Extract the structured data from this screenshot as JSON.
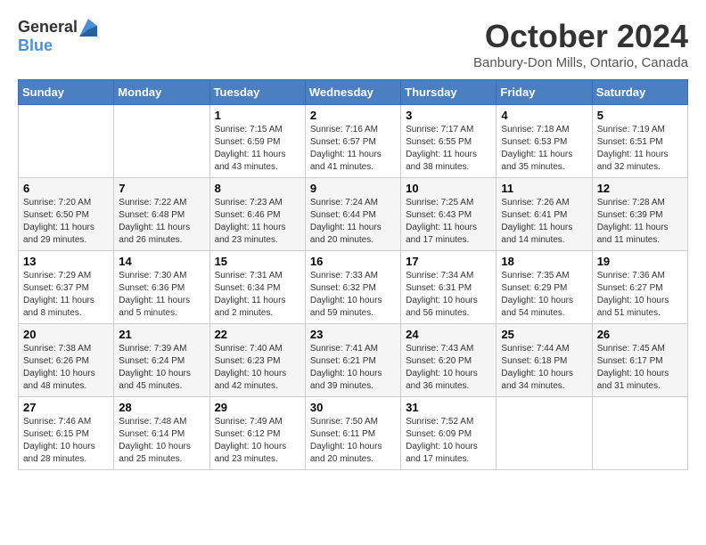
{
  "header": {
    "logo_general": "General",
    "logo_blue": "Blue",
    "month_title": "October 2024",
    "location": "Banbury-Don Mills, Ontario, Canada"
  },
  "weekdays": [
    "Sunday",
    "Monday",
    "Tuesday",
    "Wednesday",
    "Thursday",
    "Friday",
    "Saturday"
  ],
  "weeks": [
    [
      {
        "day": "",
        "info": ""
      },
      {
        "day": "",
        "info": ""
      },
      {
        "day": "1",
        "info": "Sunrise: 7:15 AM\nSunset: 6:59 PM\nDaylight: 11 hours and 43 minutes."
      },
      {
        "day": "2",
        "info": "Sunrise: 7:16 AM\nSunset: 6:57 PM\nDaylight: 11 hours and 41 minutes."
      },
      {
        "day": "3",
        "info": "Sunrise: 7:17 AM\nSunset: 6:55 PM\nDaylight: 11 hours and 38 minutes."
      },
      {
        "day": "4",
        "info": "Sunrise: 7:18 AM\nSunset: 6:53 PM\nDaylight: 11 hours and 35 minutes."
      },
      {
        "day": "5",
        "info": "Sunrise: 7:19 AM\nSunset: 6:51 PM\nDaylight: 11 hours and 32 minutes."
      }
    ],
    [
      {
        "day": "6",
        "info": "Sunrise: 7:20 AM\nSunset: 6:50 PM\nDaylight: 11 hours and 29 minutes."
      },
      {
        "day": "7",
        "info": "Sunrise: 7:22 AM\nSunset: 6:48 PM\nDaylight: 11 hours and 26 minutes."
      },
      {
        "day": "8",
        "info": "Sunrise: 7:23 AM\nSunset: 6:46 PM\nDaylight: 11 hours and 23 minutes."
      },
      {
        "day": "9",
        "info": "Sunrise: 7:24 AM\nSunset: 6:44 PM\nDaylight: 11 hours and 20 minutes."
      },
      {
        "day": "10",
        "info": "Sunrise: 7:25 AM\nSunset: 6:43 PM\nDaylight: 11 hours and 17 minutes."
      },
      {
        "day": "11",
        "info": "Sunrise: 7:26 AM\nSunset: 6:41 PM\nDaylight: 11 hours and 14 minutes."
      },
      {
        "day": "12",
        "info": "Sunrise: 7:28 AM\nSunset: 6:39 PM\nDaylight: 11 hours and 11 minutes."
      }
    ],
    [
      {
        "day": "13",
        "info": "Sunrise: 7:29 AM\nSunset: 6:37 PM\nDaylight: 11 hours and 8 minutes."
      },
      {
        "day": "14",
        "info": "Sunrise: 7:30 AM\nSunset: 6:36 PM\nDaylight: 11 hours and 5 minutes."
      },
      {
        "day": "15",
        "info": "Sunrise: 7:31 AM\nSunset: 6:34 PM\nDaylight: 11 hours and 2 minutes."
      },
      {
        "day": "16",
        "info": "Sunrise: 7:33 AM\nSunset: 6:32 PM\nDaylight: 10 hours and 59 minutes."
      },
      {
        "day": "17",
        "info": "Sunrise: 7:34 AM\nSunset: 6:31 PM\nDaylight: 10 hours and 56 minutes."
      },
      {
        "day": "18",
        "info": "Sunrise: 7:35 AM\nSunset: 6:29 PM\nDaylight: 10 hours and 54 minutes."
      },
      {
        "day": "19",
        "info": "Sunrise: 7:36 AM\nSunset: 6:27 PM\nDaylight: 10 hours and 51 minutes."
      }
    ],
    [
      {
        "day": "20",
        "info": "Sunrise: 7:38 AM\nSunset: 6:26 PM\nDaylight: 10 hours and 48 minutes."
      },
      {
        "day": "21",
        "info": "Sunrise: 7:39 AM\nSunset: 6:24 PM\nDaylight: 10 hours and 45 minutes."
      },
      {
        "day": "22",
        "info": "Sunrise: 7:40 AM\nSunset: 6:23 PM\nDaylight: 10 hours and 42 minutes."
      },
      {
        "day": "23",
        "info": "Sunrise: 7:41 AM\nSunset: 6:21 PM\nDaylight: 10 hours and 39 minutes."
      },
      {
        "day": "24",
        "info": "Sunrise: 7:43 AM\nSunset: 6:20 PM\nDaylight: 10 hours and 36 minutes."
      },
      {
        "day": "25",
        "info": "Sunrise: 7:44 AM\nSunset: 6:18 PM\nDaylight: 10 hours and 34 minutes."
      },
      {
        "day": "26",
        "info": "Sunrise: 7:45 AM\nSunset: 6:17 PM\nDaylight: 10 hours and 31 minutes."
      }
    ],
    [
      {
        "day": "27",
        "info": "Sunrise: 7:46 AM\nSunset: 6:15 PM\nDaylight: 10 hours and 28 minutes."
      },
      {
        "day": "28",
        "info": "Sunrise: 7:48 AM\nSunset: 6:14 PM\nDaylight: 10 hours and 25 minutes."
      },
      {
        "day": "29",
        "info": "Sunrise: 7:49 AM\nSunset: 6:12 PM\nDaylight: 10 hours and 23 minutes."
      },
      {
        "day": "30",
        "info": "Sunrise: 7:50 AM\nSunset: 6:11 PM\nDaylight: 10 hours and 20 minutes."
      },
      {
        "day": "31",
        "info": "Sunrise: 7:52 AM\nSunset: 6:09 PM\nDaylight: 10 hours and 17 minutes."
      },
      {
        "day": "",
        "info": ""
      },
      {
        "day": "",
        "info": ""
      }
    ]
  ]
}
